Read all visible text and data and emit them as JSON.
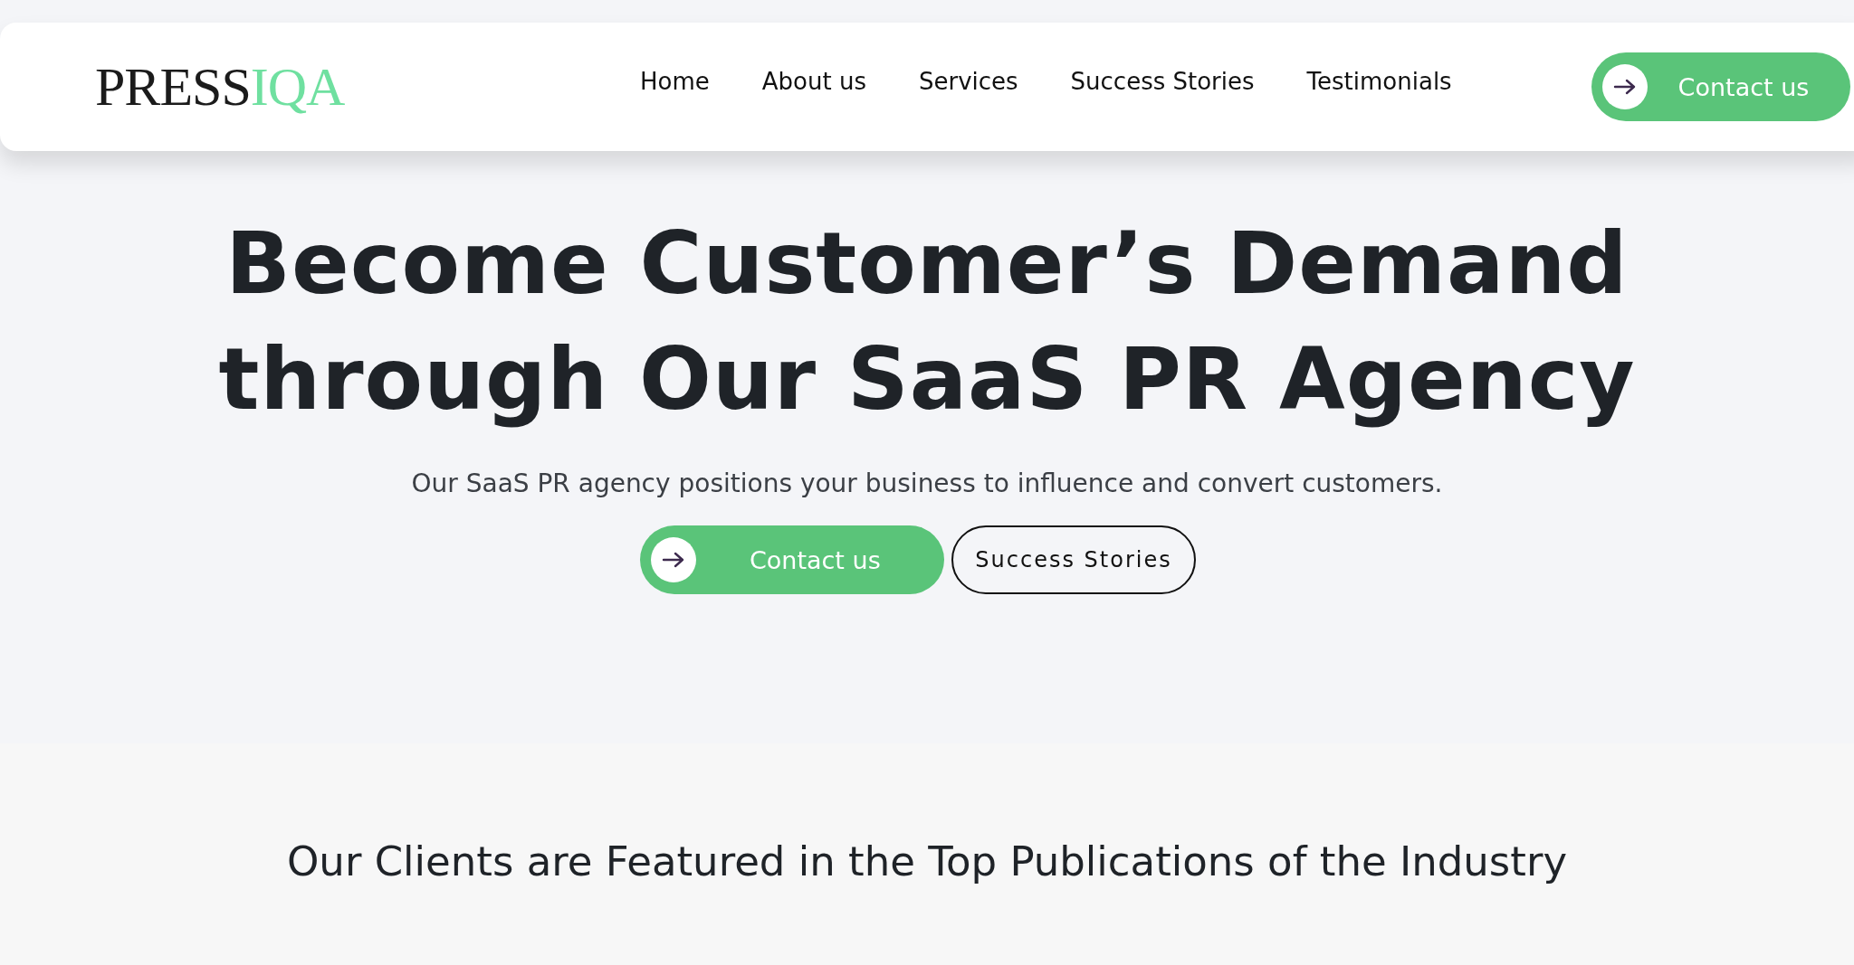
{
  "header": {
    "logo": {
      "text": "PRESS",
      "accent": "IQA"
    },
    "nav": [
      {
        "label": "Home"
      },
      {
        "label": "About us"
      },
      {
        "label": "Services"
      },
      {
        "label": "Success Stories"
      },
      {
        "label": "Testimonials"
      }
    ],
    "cta": {
      "label": "Contact us"
    }
  },
  "hero": {
    "title_lines": [
      "Become Customer’s Demand",
      "through Our SaaS PR Agency"
    ],
    "subtitle": "Our SaaS PR agency positions your business to influence and convert customers.",
    "buttons": [
      {
        "kind": "primary",
        "label": "Contact us"
      },
      {
        "kind": "outline",
        "label": "Success Stories"
      }
    ]
  },
  "clients": {
    "heading": "Our Clients are Featured in the Top Publications of the Industry"
  }
}
